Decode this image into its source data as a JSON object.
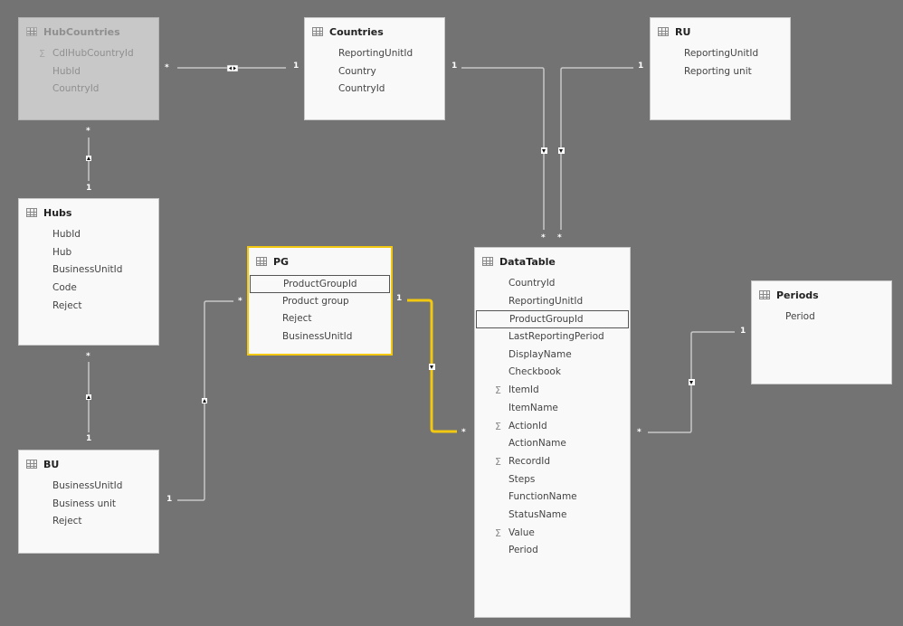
{
  "tables": {
    "hubcountries": {
      "name": "HubCountries",
      "state": "dimmed",
      "fields": [
        {
          "label": "CdlHubCountryId",
          "sigma": true
        },
        {
          "label": "HubId",
          "sigma": false
        },
        {
          "label": "CountryId",
          "sigma": false
        }
      ]
    },
    "countries": {
      "name": "Countries",
      "fields": [
        {
          "label": "ReportingUnitId",
          "sigma": false
        },
        {
          "label": "Country",
          "sigma": false
        },
        {
          "label": "CountryId",
          "sigma": false
        }
      ]
    },
    "ru": {
      "name": "RU",
      "fields": [
        {
          "label": "ReportingUnitId",
          "sigma": false
        },
        {
          "label": "Reporting unit",
          "sigma": false
        }
      ]
    },
    "hubs": {
      "name": "Hubs",
      "fields": [
        {
          "label": "HubId"
        },
        {
          "label": "Hub"
        },
        {
          "label": "BusinessUnitId"
        },
        {
          "label": "Code"
        },
        {
          "label": "Reject"
        }
      ]
    },
    "pg": {
      "name": "PG",
      "state": "selected",
      "fields": [
        {
          "label": "ProductGroupId",
          "highlighted": true
        },
        {
          "label": "Product group"
        },
        {
          "label": "Reject"
        },
        {
          "label": "BusinessUnitId"
        }
      ]
    },
    "datatable": {
      "name": "DataTable",
      "fields": [
        {
          "label": "CountryId"
        },
        {
          "label": "ReportingUnitId"
        },
        {
          "label": "ProductGroupId",
          "highlighted": true
        },
        {
          "label": "LastReportingPeriod"
        },
        {
          "label": "DisplayName"
        },
        {
          "label": "Checkbook"
        },
        {
          "label": "ItemId",
          "sigma": true
        },
        {
          "label": "ItemName"
        },
        {
          "label": "ActionId",
          "sigma": true
        },
        {
          "label": "ActionName"
        },
        {
          "label": "RecordId",
          "sigma": true
        },
        {
          "label": "Steps"
        },
        {
          "label": "FunctionName"
        },
        {
          "label": "StatusName"
        },
        {
          "label": "Value",
          "sigma": true
        },
        {
          "label": "Period"
        }
      ]
    },
    "periods": {
      "name": "Periods",
      "fields": [
        {
          "label": "Period"
        }
      ]
    },
    "bu": {
      "name": "BU",
      "fields": [
        {
          "label": "BusinessUnitId"
        },
        {
          "label": "Business unit"
        },
        {
          "label": "Reject"
        }
      ]
    }
  },
  "relationships": [
    {
      "from": "HubCountries",
      "to": "Countries",
      "from_card": "*",
      "to_card": "1",
      "direction": "both"
    },
    {
      "from": "HubCountries",
      "to": "Hubs",
      "from_card": "*",
      "to_card": "1",
      "direction": "single"
    },
    {
      "from": "Hubs",
      "to": "BU",
      "from_card": "*",
      "to_card": "1",
      "direction": "single"
    },
    {
      "from": "PG",
      "to": "BU",
      "from_card": "*",
      "to_card": "1",
      "direction": "single"
    },
    {
      "from": "PG",
      "to": "DataTable",
      "from_card": "1",
      "to_card": "*",
      "direction": "single",
      "highlighted": true
    },
    {
      "from": "Countries",
      "to": "DataTable",
      "from_card": "1",
      "to_card": "*",
      "direction": "single"
    },
    {
      "from": "RU",
      "to": "DataTable",
      "from_card": "1",
      "to_card": "*",
      "direction": "single"
    },
    {
      "from": "Periods",
      "to": "DataTable",
      "from_card": "1",
      "to_card": "*",
      "direction": "single"
    }
  ],
  "labels": {
    "one": "1",
    "many": "*",
    "sigma": "Σ"
  },
  "colors": {
    "canvas": "#737373",
    "line": "#c8c8c8",
    "highlight": "#f2c811"
  }
}
